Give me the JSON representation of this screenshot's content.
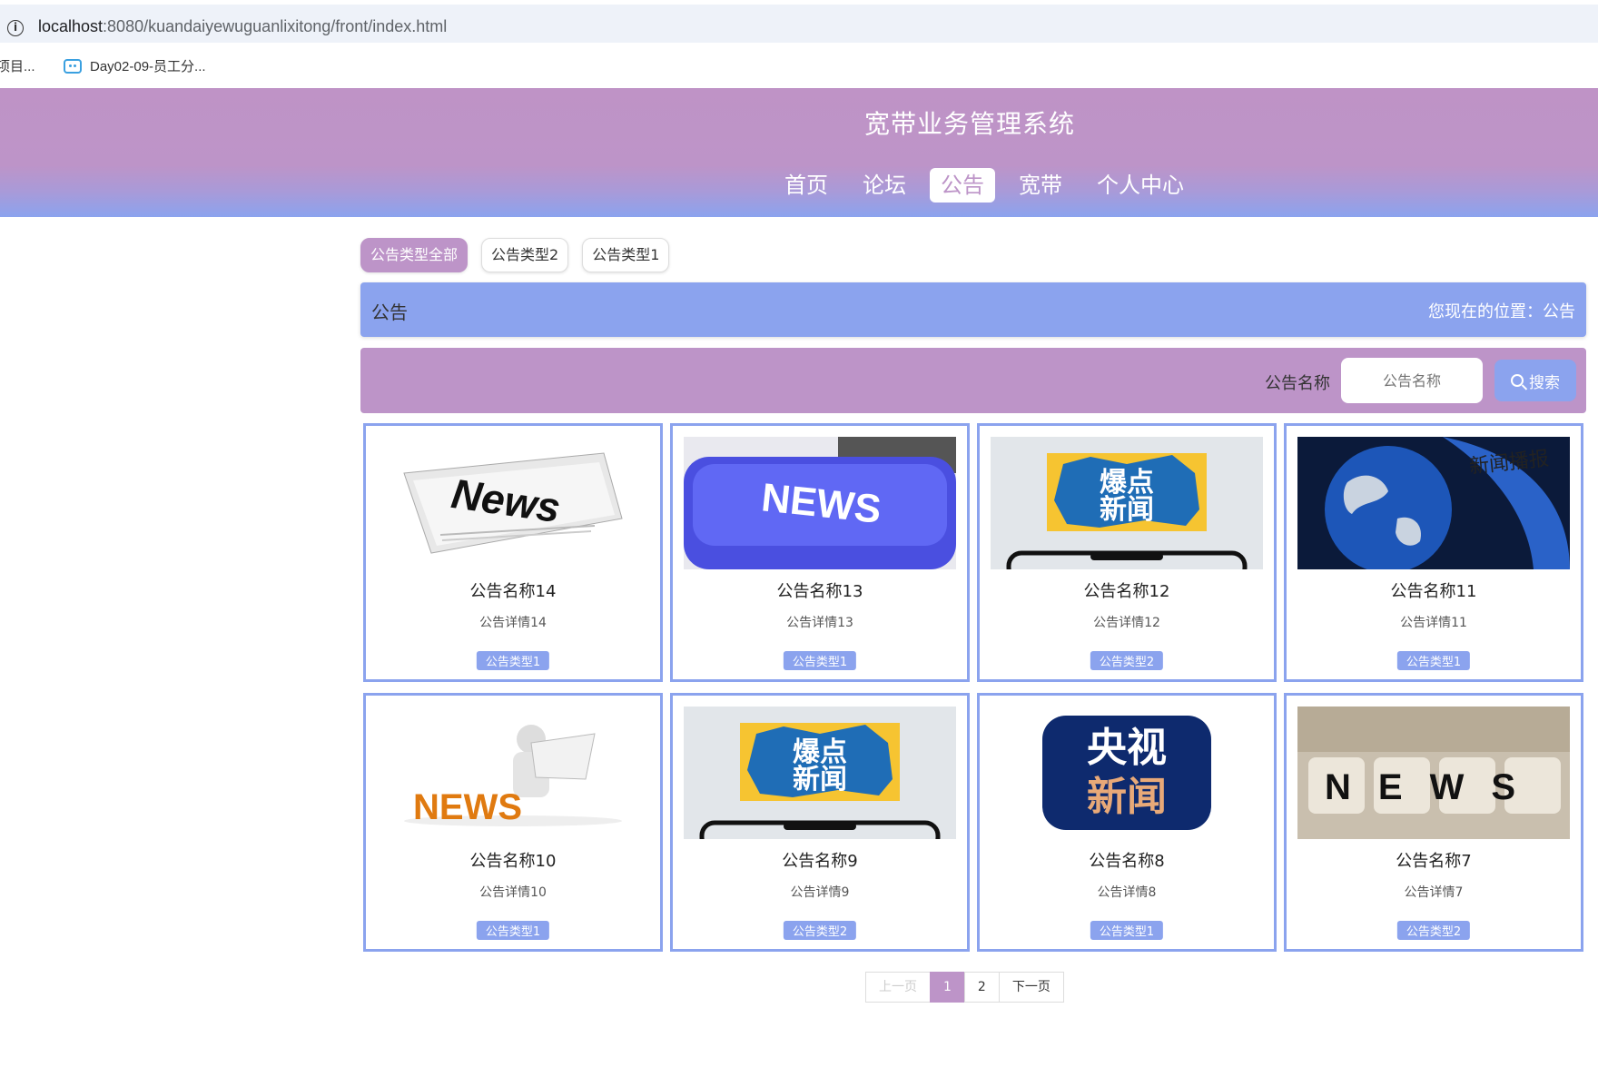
{
  "browser": {
    "url_host": "localhost",
    "url_path": ":8080/kuandaiyewuguanlixitong/front/index.html",
    "bookmarks": [
      {
        "label": "项目..."
      },
      {
        "label": "Day02-09-员工分..."
      }
    ]
  },
  "header": {
    "title": "宽带业务管理系统",
    "nav": [
      "首页",
      "论坛",
      "公告",
      "宽带",
      "个人中心"
    ],
    "active_nav": "公告"
  },
  "tabs": [
    {
      "label": "公告类型全部",
      "active": true
    },
    {
      "label": "公告类型2",
      "active": false
    },
    {
      "label": "公告类型1",
      "active": false
    }
  ],
  "title_bar": {
    "title": "公告",
    "location": "您现在的位置：公告"
  },
  "search": {
    "label": "公告名称",
    "placeholder": "公告名称",
    "button": "搜索"
  },
  "cards": [
    {
      "name": "公告名称14",
      "detail": "公告详情14",
      "type": "公告类型1",
      "image": "news-paper"
    },
    {
      "name": "公告名称13",
      "detail": "公告详情13",
      "type": "公告类型1",
      "image": "news-key"
    },
    {
      "name": "公告名称12",
      "detail": "公告详情12",
      "type": "公告类型2",
      "image": "hot-news"
    },
    {
      "name": "公告名称11",
      "detail": "公告详情11",
      "type": "公告类型1",
      "image": "globe-news"
    },
    {
      "name": "公告名称10",
      "detail": "公告详情10",
      "type": "公告类型1",
      "image": "news-figure"
    },
    {
      "name": "公告名称9",
      "detail": "公告详情9",
      "type": "公告类型2",
      "image": "hot-news"
    },
    {
      "name": "公告名称8",
      "detail": "公告详情8",
      "type": "公告类型1",
      "image": "cctv-news"
    },
    {
      "name": "公告名称7",
      "detail": "公告详情7",
      "type": "公告类型2",
      "image": "news-blocks"
    }
  ],
  "image_text": {
    "news": "News",
    "news_caps": "NEWS",
    "hot_line1": "爆点",
    "hot_line2": "新闻",
    "cctv_line1": "央视",
    "cctv_line2": "新闻",
    "globe_text": "新闻播报"
  },
  "pagination": {
    "prev": "上一页",
    "pages": [
      "1",
      "2"
    ],
    "current": "1",
    "next": "下一页"
  },
  "colors": {
    "purple": "#bd94c8",
    "blue": "#8ba3ee"
  }
}
